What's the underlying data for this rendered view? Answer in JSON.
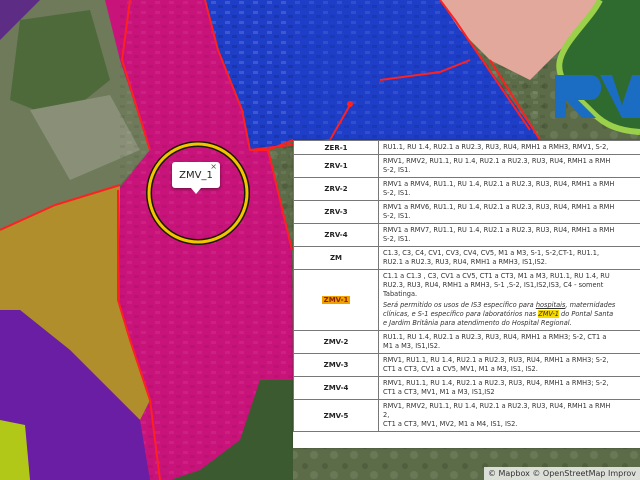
{
  "map": {
    "popup_label": "ZMV_1",
    "popup_close": "×",
    "attribution": "© Mapbox © OpenStreetMap Improv",
    "colors": {
      "magenta_zone": "#c8147a",
      "blue_zone": "#1e3ec8",
      "olive_zone": "#b08e2c",
      "purple_zone": "#6a1ea4",
      "salmon_zone": "#e0a59a",
      "border": "#ff2020",
      "highlight_ring": "#f3c400"
    }
  },
  "table": {
    "rows": [
      {
        "zone": "ZER-1",
        "uses": [
          "RU1.1, RU 1.4, RU2.1 a RU2.3, RU3, RU4, RMH1 a RMH3, RMV1, S-2,"
        ]
      },
      {
        "zone": "ZRV-1",
        "uses": [
          "RMV1, RMV2, RU1.1, RU 1.4, RU2.1 a RU2.3, RU3, RU4, RMH1 a RMH",
          "S-2, IS1."
        ]
      },
      {
        "zone": "ZRV-2",
        "uses": [
          "RMV1 a RMV4, RU1.1, RU 1.4, RU2.1 a RU2.3, RU3, RU4, RMH1 a RMH",
          "S-2, IS1."
        ]
      },
      {
        "zone": "ZRV-3",
        "uses": [
          "RMV1 a RMV6, RU1.1, RU 1.4, RU2.1 a RU2.3, RU3, RU4, RMH1 a RMH",
          "S-2, IS1."
        ]
      },
      {
        "zone": "ZRV-4",
        "uses": [
          "RMV1 a RMV7, RU1.1, RU 1.4, RU2.1 a RU2.3, RU3, RU4, RMH1 a RMH",
          "S-2, IS1."
        ]
      },
      {
        "zone": "ZM",
        "uses": [
          "C1.3, C3, C4, CV1, CV3, CV4, CV5, M1 a M3, S-1, S-2,CT-1, RU1.1,",
          "RU2.1 a RU2.3, RU3, RU4, RMH1 a RMH3, IS1,IS2."
        ]
      },
      {
        "zone": "ZMV-1",
        "highlight": true,
        "uses": [
          "C1.1 a C1.3 , C3, CV1 a CV5, CT1 a CT3, M1 a M3, RU1.1, RU 1.4, RU",
          "RU2.3, RU3, RU4, RMH1 a RMH3, S-1 ,S-2, IS1,IS2,IS3, C4 - soment",
          "Tabatinga."
        ],
        "extra_before": "Será permitido os usos de IS3 específico para ",
        "extra_u1": "hospitais",
        "extra_mid": ", maternidades",
        "extra_line2a": "clínicas, e S-1 específico para laboratórios nas ",
        "extra_hl": "ZMV-1",
        "extra_line2b": " do Pontal Santa",
        "extra_line3": "e Jardim Britânia para atendimento do Hospital Regional."
      },
      {
        "zone": "ZMV-2",
        "uses": [
          "RU1.1, RU 1.4, RU2.1 a RU2.3, RU3, RU4, RMH1 a RMH3; S-2, CT1 a",
          "M1 a M3, IS1,IS2."
        ]
      },
      {
        "zone": "ZMV-3",
        "uses": [
          "RMV1, RU1.1, RU 1.4, RU2.1 a RU2.3, RU3, RU4, RMH1 a RMH3; S-2,",
          "CT1 a CT3, CV1 a CV5, MV1, M1 a M3, IS1, IS2."
        ]
      },
      {
        "zone": "ZMV-4",
        "uses": [
          "RMV1, RU1.1, RU 1.4, RU2.1 a RU2.3, RU3, RU4, RMH1 a RMH3; S-2,",
          "CT1 a CT3, MV1, M1 a M3, IS1,IS2"
        ]
      },
      {
        "zone": "ZMV-5",
        "uses": [
          "RMV1, RMV2, RU1.1, RU 1.4, RU2.1 a RU2.3, RU3, RU4, RMH1 a RMH",
          "2,",
          "CT1 a CT3, MV1, MV2, M1 a M4, IS1, IS2."
        ]
      }
    ]
  }
}
